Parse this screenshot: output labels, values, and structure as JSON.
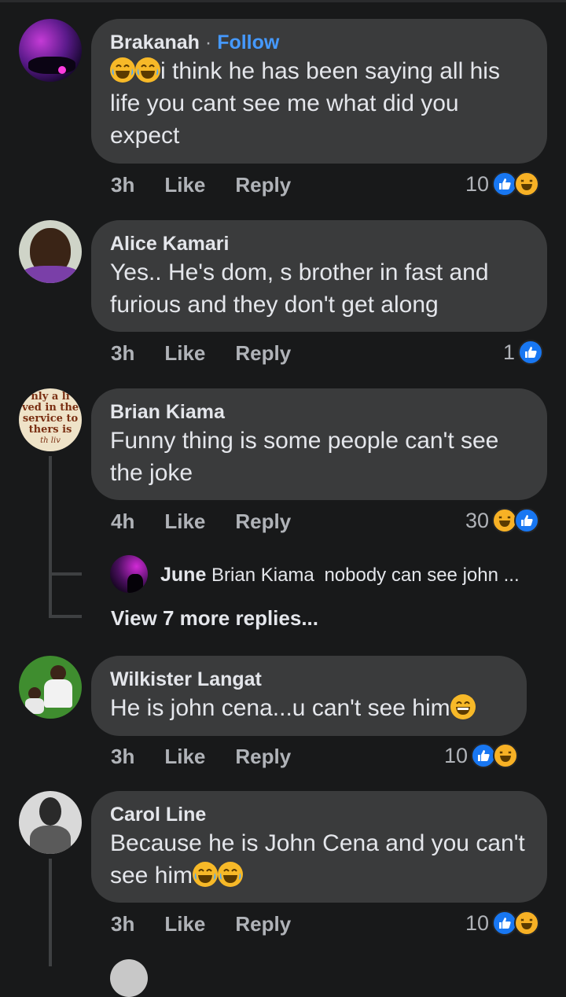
{
  "comments": [
    {
      "author": "Brakanah",
      "follow_label": "Follow",
      "separator": "·",
      "text": "i think he has been saying all his life you cant see me what did you expect",
      "leading_emojis": [
        "tears-of-joy-emoji",
        "tears-of-joy-emoji"
      ],
      "time": "3h",
      "like_label": "Like",
      "reply_label": "Reply",
      "reaction_count": "10",
      "reactions": [
        "like",
        "haha"
      ]
    },
    {
      "author": "Alice Kamari",
      "text": "Yes.. He's dom, s brother in fast and furious and they don't get along",
      "time": "3h",
      "like_label": "Like",
      "reply_label": "Reply",
      "reaction_count": "1",
      "reactions": [
        "like"
      ]
    },
    {
      "author": "Brian Kiama",
      "avatar_text": [
        "nly a li",
        "ved in the",
        "service to",
        "thers is",
        "th liv"
      ],
      "text": "Funny thing is some people can't see the joke",
      "time": "4h",
      "like_label": "Like",
      "reply_label": "Reply",
      "reaction_count": "30",
      "reactions": [
        "haha",
        "like"
      ]
    },
    {
      "author": "Wilkister Langat",
      "text": "He is john cena...u can't see him",
      "trailing_emojis": [
        "grinning-emoji"
      ],
      "time": "3h",
      "like_label": "Like",
      "reply_label": "Reply",
      "reaction_count": "10",
      "reactions": [
        "like",
        "haha"
      ]
    },
    {
      "author": "Carol Line",
      "text": "Because he is John Cena and you can't see him",
      "trailing_emojis": [
        "tears-of-joy-emoji",
        "tears-of-joy-emoji"
      ],
      "time": "3h",
      "like_label": "Like",
      "reply_label": "Reply",
      "reaction_count": "10",
      "reactions": [
        "like",
        "haha"
      ]
    }
  ],
  "reply_preview": {
    "author": "June",
    "mention": "Brian Kiama",
    "text": "nobody can see john ..."
  },
  "view_more_label": "View 7 more replies...",
  "colors": {
    "background": "#18191a",
    "bubble": "#3a3b3c",
    "link": "#4599ff",
    "like": "#1877f2",
    "haha": "#f7b125"
  }
}
